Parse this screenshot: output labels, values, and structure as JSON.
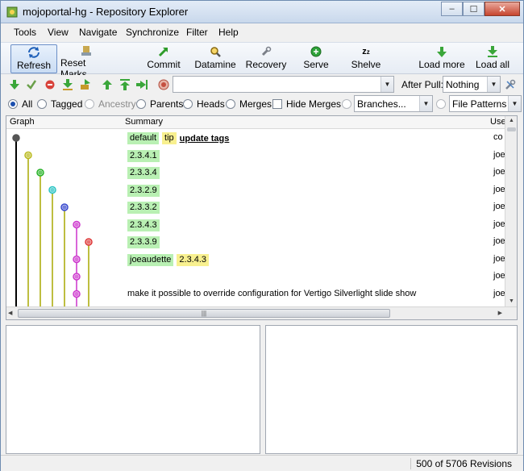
{
  "window": {
    "title": "mojoportal-hg - Repository Explorer",
    "buttons": {
      "minimize": "‒",
      "maximize": "☐",
      "close": "✕"
    }
  },
  "menu": [
    {
      "label": "Tools"
    },
    {
      "label": "View"
    },
    {
      "label": "Navigate"
    },
    {
      "label": "Synchronize"
    },
    {
      "label": "Filter"
    },
    {
      "label": "Help"
    }
  ],
  "toolbar": {
    "refresh": "Refresh",
    "reset_marks": "Reset Marks",
    "commit": "Commit",
    "datamine": "Datamine",
    "recovery": "Recovery",
    "serve": "Serve",
    "shelve": "Shelve",
    "load_more": "Load more",
    "load_all": "Load all"
  },
  "toolbar2": {
    "after_pull_label": "After Pull:",
    "after_pull_value": "Nothing",
    "path_value": ""
  },
  "filter": {
    "all": "All",
    "tagged": "Tagged",
    "ancestry": "Ancestry",
    "parents": "Parents",
    "heads": "Heads",
    "merges": "Merges",
    "hide_merges": "Hide Merges",
    "branches": "Branches...",
    "file_patterns": "File Patterns",
    "selected": "All"
  },
  "grid": {
    "columns": {
      "graph": "Graph",
      "summary": "Summary",
      "user": "Use"
    },
    "rows": [
      {
        "tags": [
          {
            "text": "default",
            "color": "green"
          },
          {
            "text": "tip",
            "color": "yellow"
          }
        ],
        "summary": "update tags",
        "user": "co"
      },
      {
        "tags": [
          {
            "text": "2.3.4.1",
            "color": "green"
          }
        ],
        "summary": "",
        "user": "joe"
      },
      {
        "tags": [
          {
            "text": "2.3.3.4",
            "color": "green"
          }
        ],
        "summary": "",
        "user": "joe"
      },
      {
        "tags": [
          {
            "text": "2.3.2.9",
            "color": "green"
          }
        ],
        "summary": "",
        "user": "joe"
      },
      {
        "tags": [
          {
            "text": "2.3.3.2",
            "color": "green"
          }
        ],
        "summary": "",
        "user": "joe"
      },
      {
        "tags": [
          {
            "text": "2.3.4.3",
            "color": "green"
          }
        ],
        "summary": "",
        "user": "joe"
      },
      {
        "tags": [
          {
            "text": "2.3.3.9",
            "color": "green"
          }
        ],
        "summary": "",
        "user": "joe"
      },
      {
        "tags": [
          {
            "text": "joeaudette",
            "color": "green"
          },
          {
            "text": "2.3.4.3",
            "color": "yellow"
          }
        ],
        "summary": "",
        "user": "joe"
      },
      {
        "tags": [],
        "summary": "",
        "user": "joe"
      },
      {
        "tags": [],
        "summary": "make it possible to override configuration for Vertigo Silverlight slide show",
        "user": "joe"
      }
    ],
    "scroll_grip": "|||"
  },
  "graph": {
    "nodes": [
      {
        "lane": 0,
        "row": 0,
        "color": "#555555"
      },
      {
        "lane": 1,
        "row": 1,
        "color": "#b8b81a"
      },
      {
        "lane": 2,
        "row": 2,
        "color": "#22b022"
      },
      {
        "lane": 3,
        "row": 3,
        "color": "#25c2c2"
      },
      {
        "lane": 4,
        "row": 4,
        "color": "#3344cc"
      },
      {
        "lane": 5,
        "row": 5,
        "color": "#cc33cc"
      },
      {
        "lane": 6,
        "row": 6,
        "color": "#dd3333"
      },
      {
        "lane": 5,
        "row": 7,
        "color": "#cc33cc"
      },
      {
        "lane": 5,
        "row": 8,
        "color": "#cc33cc"
      },
      {
        "lane": 5,
        "row": 9,
        "color": "#cc33cc"
      }
    ],
    "lane_colors": [
      "#000000",
      "#a8a800",
      "#a8a800",
      "#a8a800",
      "#a8a800",
      "#cc33cc",
      "#a8a800"
    ]
  },
  "status": {
    "revisions": "500 of 5706 Revisions"
  }
}
